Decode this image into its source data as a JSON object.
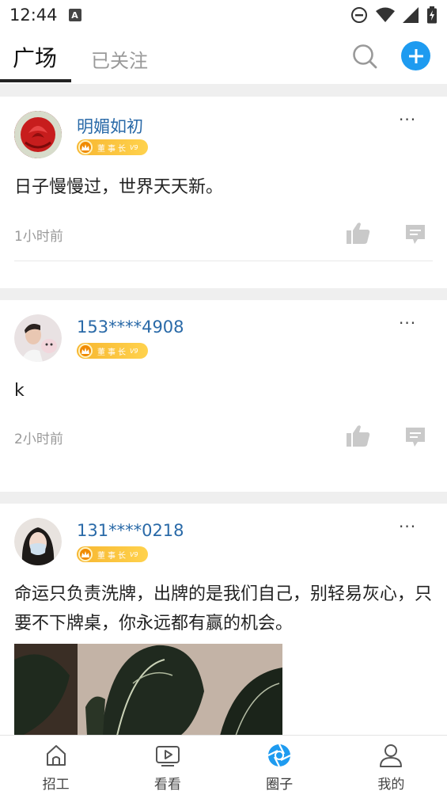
{
  "status_bar": {
    "time": "12:44",
    "notice_letter": "A"
  },
  "header": {
    "tabs": [
      {
        "label": "广场",
        "active": true
      },
      {
        "label": "已关注",
        "active": false
      }
    ],
    "search_icon": "search-icon",
    "add_icon": "plus-circle-icon",
    "accent": "#1e9bf0"
  },
  "posts": [
    {
      "username": "明媚如初",
      "badge": {
        "title": "董事长",
        "level": "V9"
      },
      "text": "日子慢慢过，世界天天新。",
      "time": "1小时前"
    },
    {
      "username": "153****4908",
      "badge": {
        "title": "董事长",
        "level": "V9"
      },
      "text": "k",
      "time": "2小时前"
    },
    {
      "username": "131****0218",
      "badge": {
        "title": "董事长",
        "level": "V9"
      },
      "text": "命运只负责洗牌，出牌的是我们自己，别轻易灰心，只要不下牌桌，你永远都有赢的机会。"
    }
  ],
  "bottom_nav": [
    {
      "label": "招工",
      "icon": "home-icon",
      "active": false
    },
    {
      "label": "看看",
      "icon": "video-icon",
      "active": false
    },
    {
      "label": "圈子",
      "icon": "circle-aperture-icon",
      "active": true
    },
    {
      "label": "我的",
      "icon": "person-icon",
      "active": false
    }
  ],
  "colors": {
    "username": "#2a6aa8",
    "badge": "#f7b731",
    "active_nav": "#1e9bf0"
  }
}
